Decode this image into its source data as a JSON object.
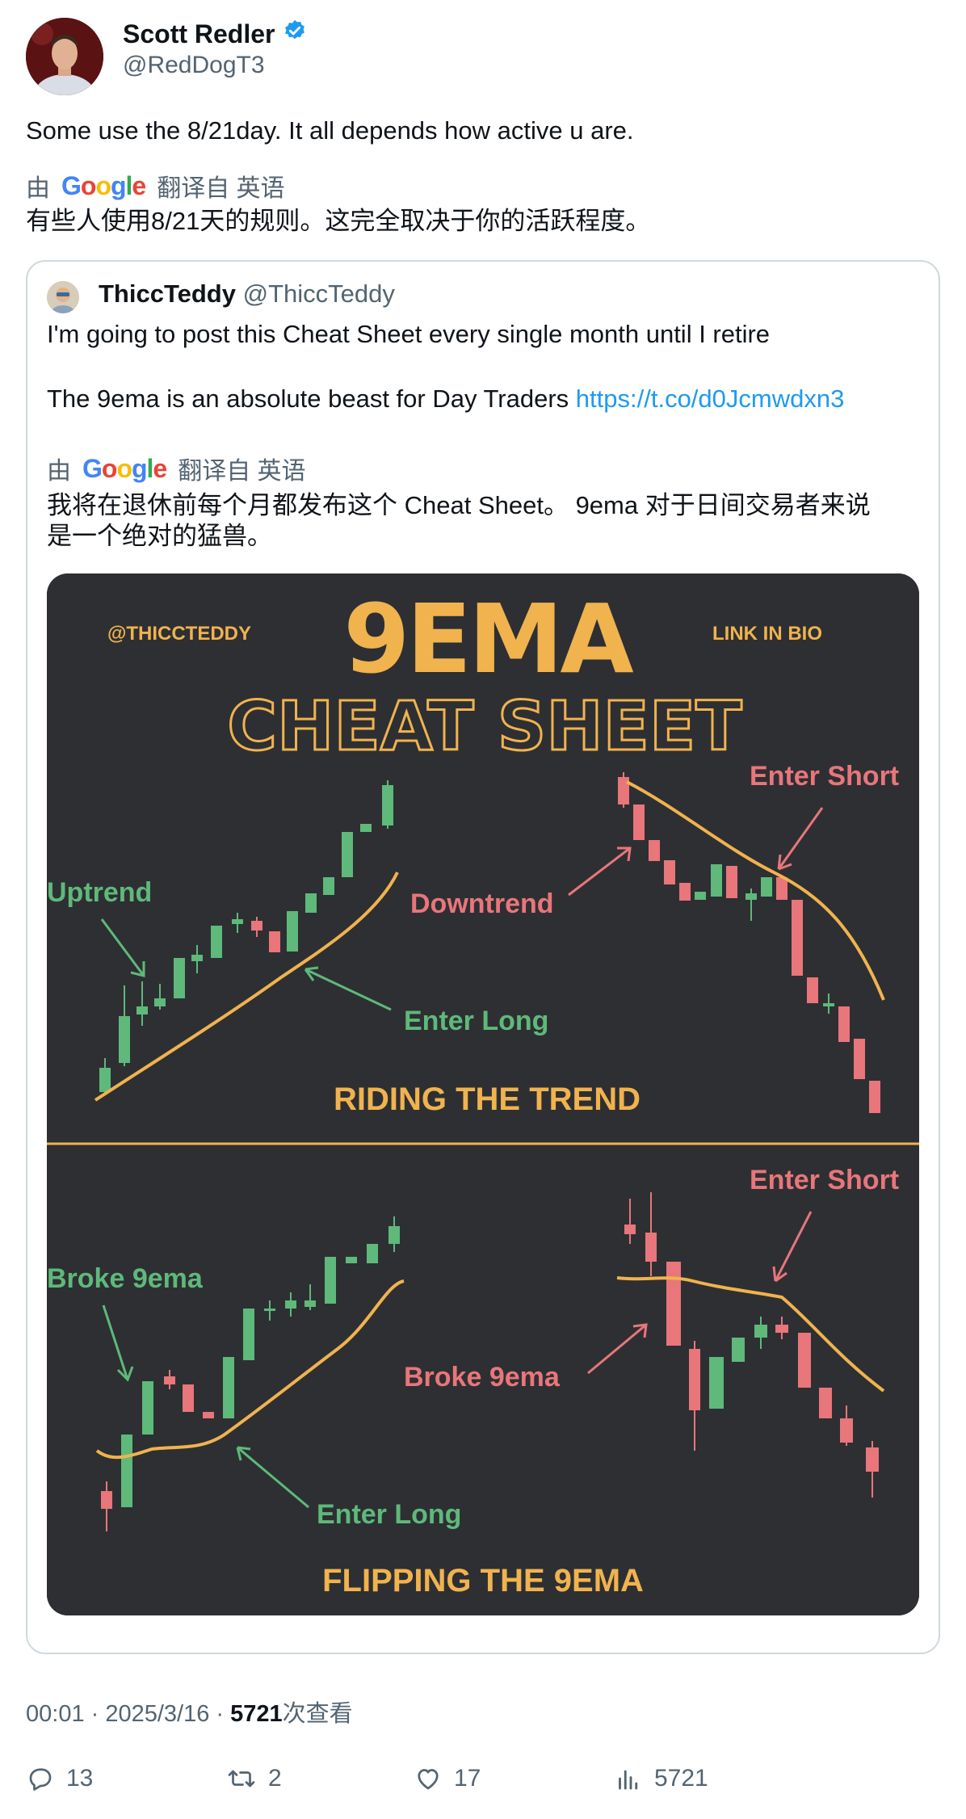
{
  "author": {
    "name": "Scott Redler",
    "handle": "@RedDogT3",
    "verified_color": "#1d9bf0"
  },
  "tweet": {
    "text": "Some use the 8/21day. It all depends how active u are.",
    "translation_prefix": "由",
    "translation_brand": "Google",
    "translation_suffix": "翻译自 英语",
    "translated": "有些人使用8/21天的规则。这完全取决于你的活跃程度。"
  },
  "quote": {
    "name": "ThiccTeddy",
    "handle": "@ThiccTeddy",
    "line1": "I'm going to post this Cheat Sheet every single month until I retire",
    "line2": "The 9ema is an absolute beast for Day Traders ",
    "link": "https://t.co/d0Jcmwdxn3",
    "translation_prefix": "由",
    "translation_brand": "Google",
    "translation_suffix": "翻译自 英语",
    "translated_line1": "我将在退休前每个月都发布这个 Cheat Sheet。 9ema 对于日间交易者来说",
    "translated_line2": "是一个绝对的猛兽。"
  },
  "cheat_sheet": {
    "handle": "@THICCTEDDY",
    "title": "9EMA",
    "subtitle": "CHEAT SHEET",
    "link_label": "LINK IN BIO",
    "uptrend": "Uptrend",
    "downtrend": "Downtrend",
    "enter_short_1": "Enter Short",
    "enter_long_1": "Enter Long",
    "section1": "RIDING THE TREND",
    "broke_left": "Broke 9ema",
    "broke_right": "Broke 9ema",
    "enter_short_2": "Enter Short",
    "enter_long_2": "Enter Long",
    "section2": "FLIPPING THE 9EMA",
    "colors": {
      "gold": "#f0b34e",
      "green": "#5eb97a",
      "red": "#e8767a",
      "bg": "#2e2f33"
    }
  },
  "meta": {
    "time": "00:01",
    "date": "2025/3/16",
    "views": "5721",
    "views_label": "次查看"
  },
  "actions": {
    "replies": "13",
    "retweets": "2",
    "likes": "17",
    "views": "5721"
  }
}
